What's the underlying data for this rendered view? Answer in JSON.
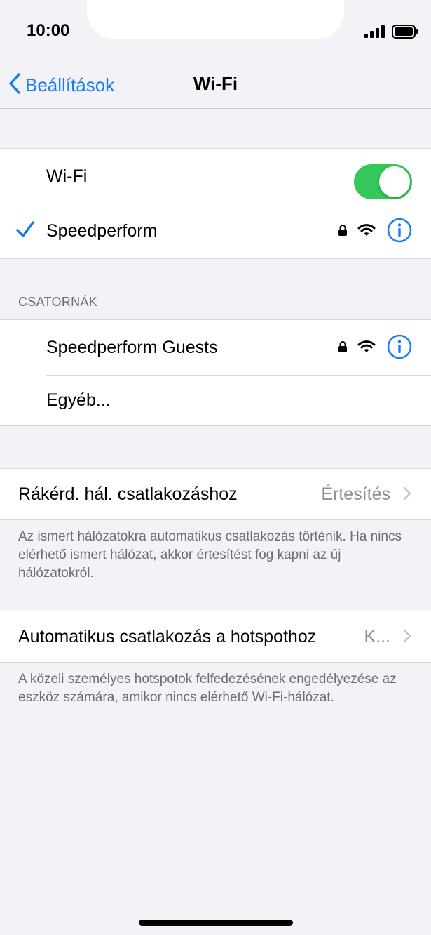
{
  "status_bar": {
    "time": "10:00"
  },
  "navbar": {
    "back_label": "Beállítások",
    "title": "Wi-Fi"
  },
  "wifi_group": {
    "toggle_label": "Wi-Fi",
    "toggle_on": true,
    "connected_network": "Speedperform"
  },
  "channels": {
    "header": "CSATORNÁK",
    "networks": [
      {
        "name": "Speedperform Guests"
      }
    ],
    "other_label": "Egyéb..."
  },
  "ask_join": {
    "label": "Rákérd. hál. csatlakozáshoz",
    "value": "Értesítés",
    "footer": "Az ismert hálózatokra automatikus csatlakozás történik. Ha nincs elérhető ismert hálózat, akkor értesítést fog kapni az új hálózatokról."
  },
  "hotspot": {
    "label": "Automatikus csatlakozás a hotspothoz",
    "value": "K...",
    "footer": "A közeli személyes hotspotok felfedezésének engedélyezése az eszköz számára, amikor nincs elérhető Wi-Fi-hálózat."
  },
  "colors": {
    "accent": "#1A7CF5",
    "toggle_on": "#34C759",
    "background": "#F2F2F7",
    "secondary_text": "#6D6D72"
  },
  "icons": [
    "signal-icon",
    "battery-icon",
    "back-chevron-icon",
    "checkmark-icon",
    "lock-icon",
    "wifi-icon",
    "info-icon",
    "chevron-right-icon"
  ]
}
